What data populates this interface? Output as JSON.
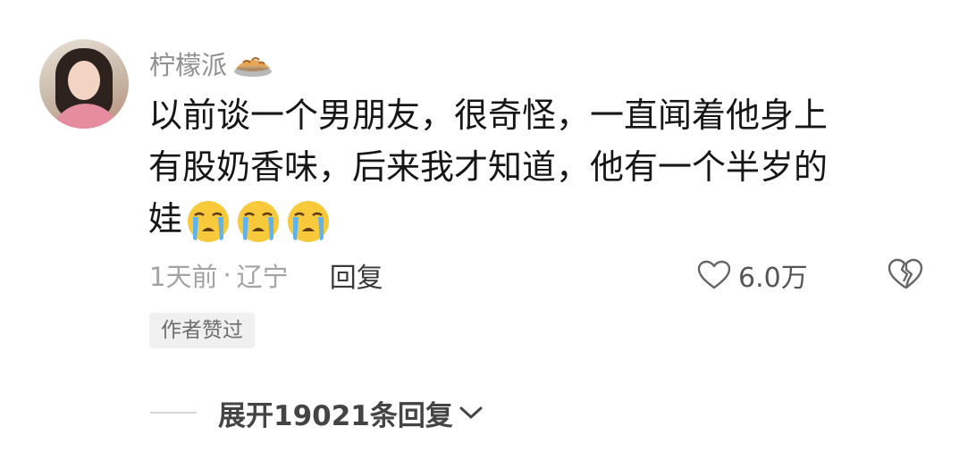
{
  "comment": {
    "username": "柠檬派",
    "content_lines": [
      "以前谈一个男朋友，很奇怪，一直闻着他身上",
      "有股奶香味，后来我才知道，他有一个半岁的",
      "娃"
    ],
    "emojis": [
      "crying-face-icon",
      "crying-face-icon",
      "crying-face-icon"
    ],
    "time": "1天前",
    "separator": "·",
    "location": "辽宁",
    "reply_label": "回复",
    "like_count": "6.0万",
    "author_badge": "作者赞过",
    "expand_replies_label": "展开19021条回复"
  },
  "colors": {
    "username": "#8f8f8f",
    "text": "#161616",
    "meta": "#a3a3a3",
    "badge_bg": "#f0f0f0"
  }
}
